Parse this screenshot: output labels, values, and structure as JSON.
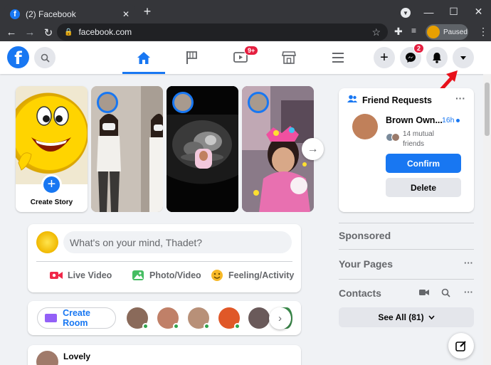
{
  "browser": {
    "tab_title": "(2) Facebook",
    "tab_favicon": "f",
    "new_tab": "+",
    "minimize": "—",
    "maximize": "☐",
    "close": "✕",
    "url": "facebook.com",
    "profile_status": "Paused"
  },
  "header": {
    "logo": "f",
    "nav": [
      {
        "name": "home",
        "active": true
      },
      {
        "name": "pages",
        "active": false
      },
      {
        "name": "watch",
        "badge": "9+"
      },
      {
        "name": "marketplace"
      },
      {
        "name": "menu"
      }
    ],
    "messenger_badge": "2"
  },
  "stories": {
    "create_label": "Create Story"
  },
  "composer": {
    "placeholder": "What's on your mind, Thadet?",
    "actions": [
      "Live Video",
      "Photo/Video",
      "Feeling/Activity"
    ]
  },
  "rooms": {
    "create_label": "Create Room"
  },
  "post": {
    "author": "Lovely"
  },
  "friend_requests": {
    "title": "Friend Requests",
    "more": "···",
    "name": "Brown Own...",
    "time": "16h",
    "mutual_line1": "14 mutual",
    "mutual_line2": "friends",
    "confirm": "Confirm",
    "delete": "Delete"
  },
  "sidebar": {
    "sponsored": "Sponsored",
    "your_pages": "Your Pages",
    "contacts": "Contacts",
    "see_all": "See All (81)"
  },
  "colors": {
    "brand": "#1877f2",
    "badge": "#e41e3f",
    "online": "#31a24c",
    "annotation_arrow": "#e8101a"
  }
}
